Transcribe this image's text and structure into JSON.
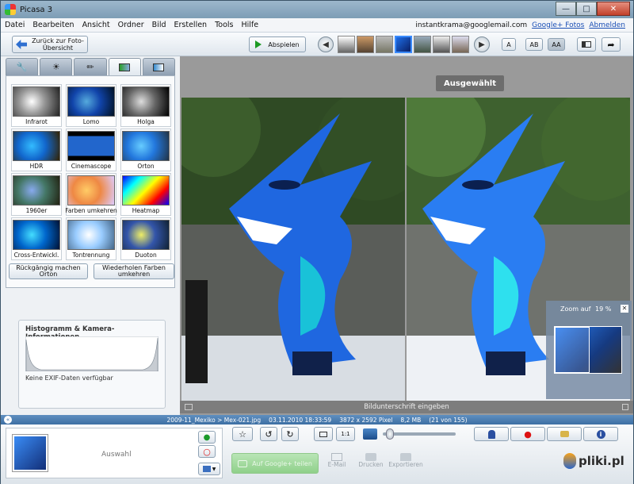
{
  "window": {
    "title": "Picasa 3"
  },
  "menu": {
    "items": [
      "Datei",
      "Bearbeiten",
      "Ansicht",
      "Ordner",
      "Bild",
      "Erstellen",
      "Tools",
      "Hilfe"
    ],
    "account": "instantkrama@googlemail.com",
    "google_fotos": "Google+ Fotos",
    "abmelden": "Abmelden"
  },
  "toolbar": {
    "back_label": "Zurück zur Foto-Übersicht",
    "play_label": "Abspielen",
    "text_a": "A",
    "text_ab": "AB",
    "text_aa": "AA"
  },
  "effects": [
    {
      "label": "Infrarot"
    },
    {
      "label": "Lomo"
    },
    {
      "label": "Holga"
    },
    {
      "label": "HDR"
    },
    {
      "label": "Cinemascope"
    },
    {
      "label": "Orton"
    },
    {
      "label": "1960er"
    },
    {
      "label": "Farben umkehren"
    },
    {
      "label": "Heatmap"
    },
    {
      "label": "Cross-Entwickl."
    },
    {
      "label": "Tontrennung"
    },
    {
      "label": "Duoton"
    }
  ],
  "actions": {
    "undo_label": "Rückgängig machen Orton",
    "redo_label": "Wiederholen Farben umkehren"
  },
  "histogram": {
    "title": "Histogramm & Kamera-Informationen",
    "exif": "Keine EXIF-Daten verfügbar"
  },
  "viewer": {
    "selected_badge": "Ausgewählt",
    "zoom_label": "Zoom auf",
    "zoom_value": "19 %",
    "caption_placeholder": "Bildunterschrift eingeben"
  },
  "status": {
    "path": "2009-11_Mexiko > Mex-021.jpg",
    "date": "03.11.2010 18:33:59",
    "dims": "3872 x 2592 Pixel",
    "size": "8,2 MB",
    "count": "(21 von 155)"
  },
  "tray": {
    "selection_label": "Auswahl",
    "upload_label": "Auf Google+ teilen",
    "email_label": "E-Mail",
    "print_label": "Drucken",
    "export_label": "Exportieren",
    "watermark": "pliki.pl"
  }
}
